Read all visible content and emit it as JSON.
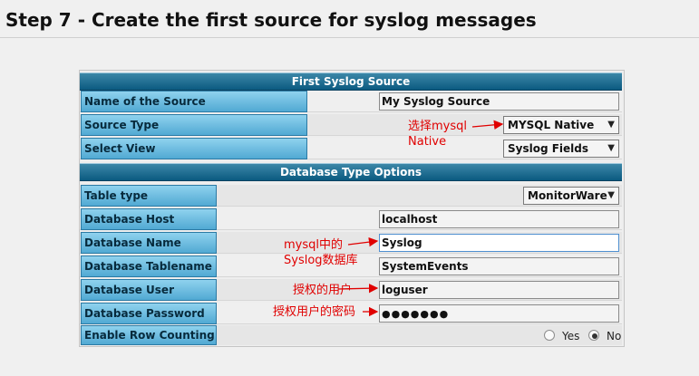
{
  "page": {
    "title": "Step 7 - Create the first source for syslog messages"
  },
  "first_source": {
    "header": "First Syslog Source",
    "rows": [
      {
        "label": "Name of the Source",
        "value": "My Syslog Source"
      },
      {
        "label": "Source Type",
        "value": "MYSQL Native"
      },
      {
        "label": "Select View",
        "value": "Syslog Fields"
      }
    ]
  },
  "db_options": {
    "header": "Database Type Options",
    "table_type": {
      "label": "Table type",
      "value": "MonitorWare"
    },
    "host": {
      "label": "Database Host",
      "value": "localhost"
    },
    "name": {
      "label": "Database Name",
      "value": "Syslog"
    },
    "tablename": {
      "label": "Database Tablename",
      "value": "SystemEvents"
    },
    "user": {
      "label": "Database User",
      "value": "loguser"
    },
    "password": {
      "label": "Database Password",
      "value": "●●●●●●●"
    },
    "row_counting": {
      "label": "Enable Row Counting",
      "yes": "Yes",
      "no": "No",
      "selected": "No"
    }
  },
  "annotations": {
    "source_type_line1": "选择mysql",
    "source_type_line2": "Native",
    "db_name_line1": "mysql中的",
    "db_name_line2": "Syslog数据库",
    "db_user": "授权的用户",
    "db_password": "授权用户的密码"
  },
  "colors": {
    "header": "#0b5a80",
    "label": "#6ec2e6",
    "annotation": "#e00000"
  }
}
